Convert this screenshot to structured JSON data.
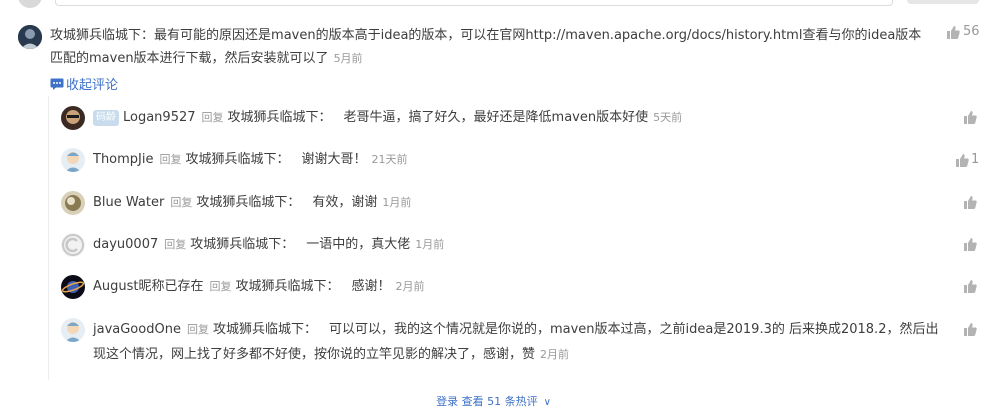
{
  "main": {
    "author": "攻城狮兵临城下",
    "colon": "：",
    "text": "最有可能的原因还是maven的版本高于idea的版本，可以在官网http://maven.apache.org/docs/history.html查看与你的idea版本匹配的maven版本进行下载，然后安装就可以了",
    "time": "5月前",
    "likes": "56"
  },
  "collapse_label": "收起评论",
  "reply_tag": "回复",
  "reply_target": "攻城狮兵临城下：",
  "replies": [
    {
      "badge": "码龄",
      "user": "Logan9527",
      "text": "老哥牛逼，搞了好久，最好还是降低maven版本好使",
      "time": "5天前",
      "likes": ""
    },
    {
      "user": "ThompJie",
      "text": "谢谢大哥！",
      "time": "21天前",
      "likes": "1"
    },
    {
      "user": "Blue Water",
      "text": "有效，谢谢",
      "time": "1月前",
      "likes": ""
    },
    {
      "user": "dayu0007",
      "text": "一语中的，真大佬",
      "time": "1月前",
      "likes": ""
    },
    {
      "user": "August昵称已存在",
      "text": "感谢！",
      "time": "2月前",
      "likes": ""
    },
    {
      "user": "javaGoodOne",
      "text": "可以可以，我的这个情况就是你说的，maven版本过高，之前idea是2019.3的 后来换成2018.2，然后出现这个情况，网上找了好多都不好使，按你说的立竿见影的解决了，感谢，赞",
      "time": "2月前",
      "likes": ""
    }
  ],
  "more_label": "登录 查看 51 条热评",
  "colors": {
    "link": "#3e71c8",
    "meta": "#999999",
    "text": "#3d3d3d"
  }
}
